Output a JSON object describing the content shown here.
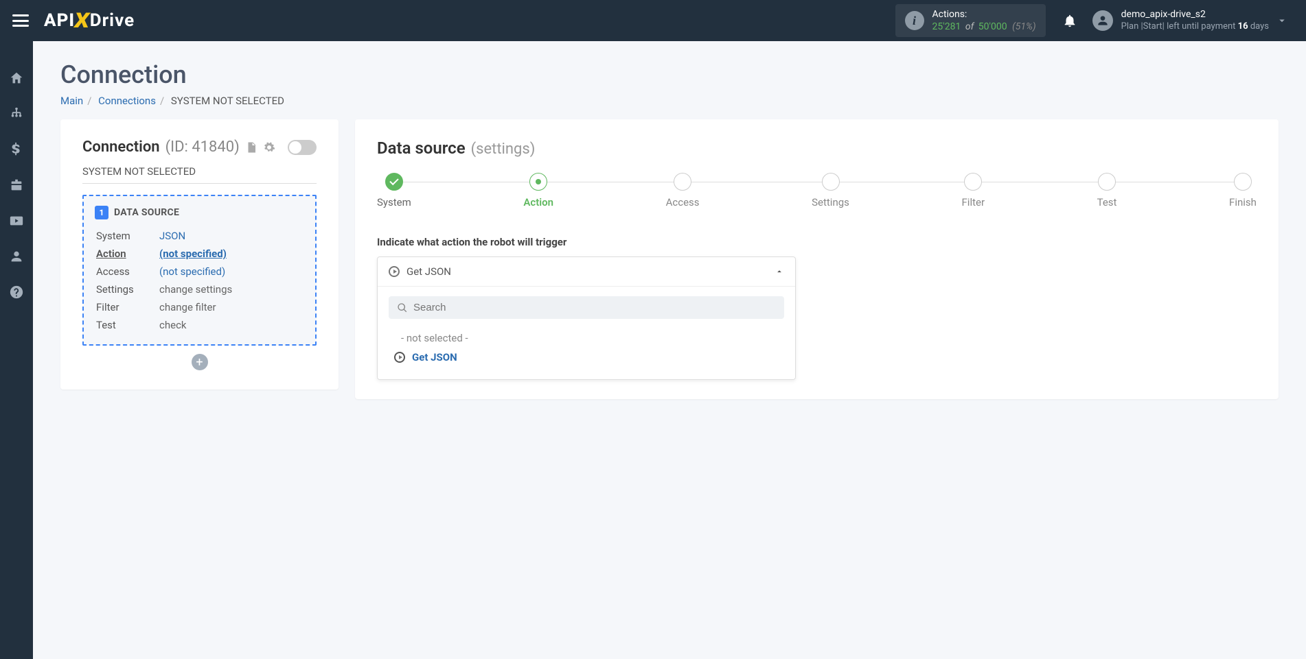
{
  "header": {
    "actions_label": "Actions:",
    "actions_used": "25'281",
    "actions_of": "of",
    "actions_total": "50'000",
    "actions_pct": "(51%)",
    "username": "demo_apix-drive_s2",
    "plan_prefix": "Plan |Start| left until payment ",
    "plan_days": "16",
    "plan_suffix": " days"
  },
  "page": {
    "title": "Connection",
    "bc_main": "Main",
    "bc_conn": "Connections",
    "bc_current": "SYSTEM NOT SELECTED"
  },
  "left": {
    "title": "Connection",
    "id_label": "(ID: 41840)",
    "sys_not": "SYSTEM NOT SELECTED",
    "box_num": "1",
    "box_title": "DATA SOURCE",
    "rows": {
      "system_l": "System",
      "system_v": "JSON",
      "action_l": "Action",
      "action_v": "(not specified)",
      "access_l": "Access",
      "access_v": "(not specified)",
      "settings_l": "Settings",
      "settings_v": "change settings",
      "filter_l": "Filter",
      "filter_v": "change filter",
      "test_l": "Test",
      "test_v": "check"
    }
  },
  "right": {
    "title": "Data source",
    "subtitle": "(settings)",
    "steps": [
      "System",
      "Action",
      "Access",
      "Settings",
      "Filter",
      "Test",
      "Finish"
    ],
    "field_label": "Indicate what action the robot will trigger",
    "selected": "Get JSON",
    "search_ph": "Search",
    "opt_none": "- not selected -",
    "opt_get": "Get JSON"
  }
}
